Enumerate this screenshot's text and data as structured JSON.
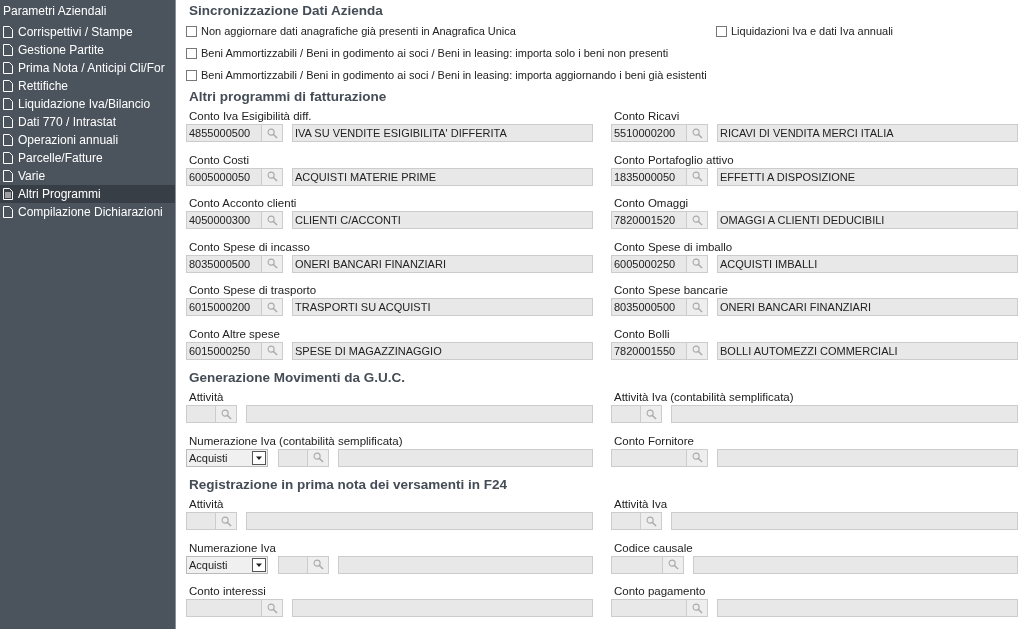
{
  "sidebar": {
    "title": "Parametri Aziendali",
    "items": [
      {
        "label": "Corrispettivi / Stampe",
        "selected": false
      },
      {
        "label": "Gestione Partite",
        "selected": false
      },
      {
        "label": "Prima Nota / Anticipi  Cli/For",
        "selected": false
      },
      {
        "label": "Rettifiche",
        "selected": false
      },
      {
        "label": "Liquidazione Iva/Bilancio",
        "selected": false
      },
      {
        "label": "Dati 770 / Intrastat",
        "selected": false
      },
      {
        "label": "Operazioni annuali",
        "selected": false
      },
      {
        "label": "Parcelle/Fatture",
        "selected": false
      },
      {
        "label": "Varie",
        "selected": false
      },
      {
        "label": "Altri Programmi",
        "selected": true
      },
      {
        "label": "Compilazione Dichiarazioni",
        "selected": false
      }
    ]
  },
  "sync": {
    "title": "Sincronizzazione Dati Azienda",
    "checkbox_rows": [
      [
        {
          "label": "Non aggiornare dati anagrafiche già presenti in Anagrafica Unica",
          "checked": false
        },
        {
          "label": "Liquidazioni Iva e dati Iva annuali",
          "checked": false
        }
      ],
      [
        {
          "label": "Beni Ammortizzabili / Beni in godimento ai soci / Beni in leasing: importa solo i beni non presenti",
          "checked": false
        }
      ],
      [
        {
          "label": "Beni Ammortizzabili / Beni in godimento ai soci / Beni in leasing: importa aggiornando i beni già esistenti",
          "checked": false
        }
      ]
    ]
  },
  "sections": [
    {
      "title": "Altri programmi di fatturazione",
      "fields": [
        {
          "label": "Conto Iva Esigibilità diff.",
          "kind": "long",
          "code": "4855000500",
          "description": "IVA SU VENDITE ESIGIBILITA' DIFFERITA"
        },
        {
          "label": "Conto Ricavi",
          "kind": "long",
          "code": "5510000200",
          "description": "RICAVI DI VENDITA MERCI ITALIA"
        },
        {
          "label": "Conto Costi",
          "kind": "long",
          "code": "6005000050",
          "description": "ACQUISTI MATERIE PRIME"
        },
        {
          "label": "Conto Portafoglio attivo",
          "kind": "long",
          "code": "1835000050",
          "description": "EFFETTI A DISPOSIZIONE"
        },
        {
          "label": "Conto Acconto clienti",
          "kind": "long",
          "code": "4050000300",
          "description": "CLIENTI C/ACCONTI"
        },
        {
          "label": "Conto Omaggi",
          "kind": "long",
          "code": "7820001520",
          "description": "OMAGGI A CLIENTI DEDUCIBILI"
        },
        {
          "label": "Conto Spese di incasso",
          "kind": "long",
          "code": "8035000500",
          "description": "ONERI BANCARI FINANZIARI"
        },
        {
          "label": "Conto Spese di imballo",
          "kind": "long",
          "code": "6005000250",
          "description": "ACQUISTI IMBALLI"
        },
        {
          "label": "Conto Spese di trasporto",
          "kind": "long",
          "code": "6015000200",
          "description": "TRASPORTI SU ACQUISTI"
        },
        {
          "label": "Conto Spese bancarie",
          "kind": "long",
          "code": "8035000500",
          "description": "ONERI BANCARI FINANZIARI"
        },
        {
          "label": "Conto Altre spese",
          "kind": "long",
          "code": "6015000250",
          "description": "SPESE DI MAGAZZINAGGIO"
        },
        {
          "label": "Conto Bolli",
          "kind": "long",
          "code": "7820001550",
          "description": "BOLLI AUTOMEZZI COMMERCIALI"
        }
      ]
    },
    {
      "title": "Generazione Movimenti da G.U.C.",
      "fields": [
        {
          "label": "Attività",
          "kind": "short"
        },
        {
          "label": "Attività Iva (contabilità semplificata)",
          "kind": "short"
        },
        {
          "label": "Numerazione Iva (contabilità semplificata)",
          "kind": "short",
          "select": "Acquisti"
        },
        {
          "label": "Conto Fornitore",
          "kind": "long"
        }
      ]
    },
    {
      "title": "Registrazione in prima nota dei versamenti in F24",
      "fields": [
        {
          "label": "Attività",
          "kind": "short"
        },
        {
          "label": "Attività Iva",
          "kind": "short"
        },
        {
          "label": "Numerazione Iva",
          "kind": "short",
          "select": "Acquisti"
        },
        {
          "label": "Codice causale",
          "kind": "medium"
        },
        {
          "label": "Conto interessi",
          "kind": "long"
        },
        {
          "label": "Conto pagamento",
          "kind": "long"
        }
      ]
    }
  ]
}
